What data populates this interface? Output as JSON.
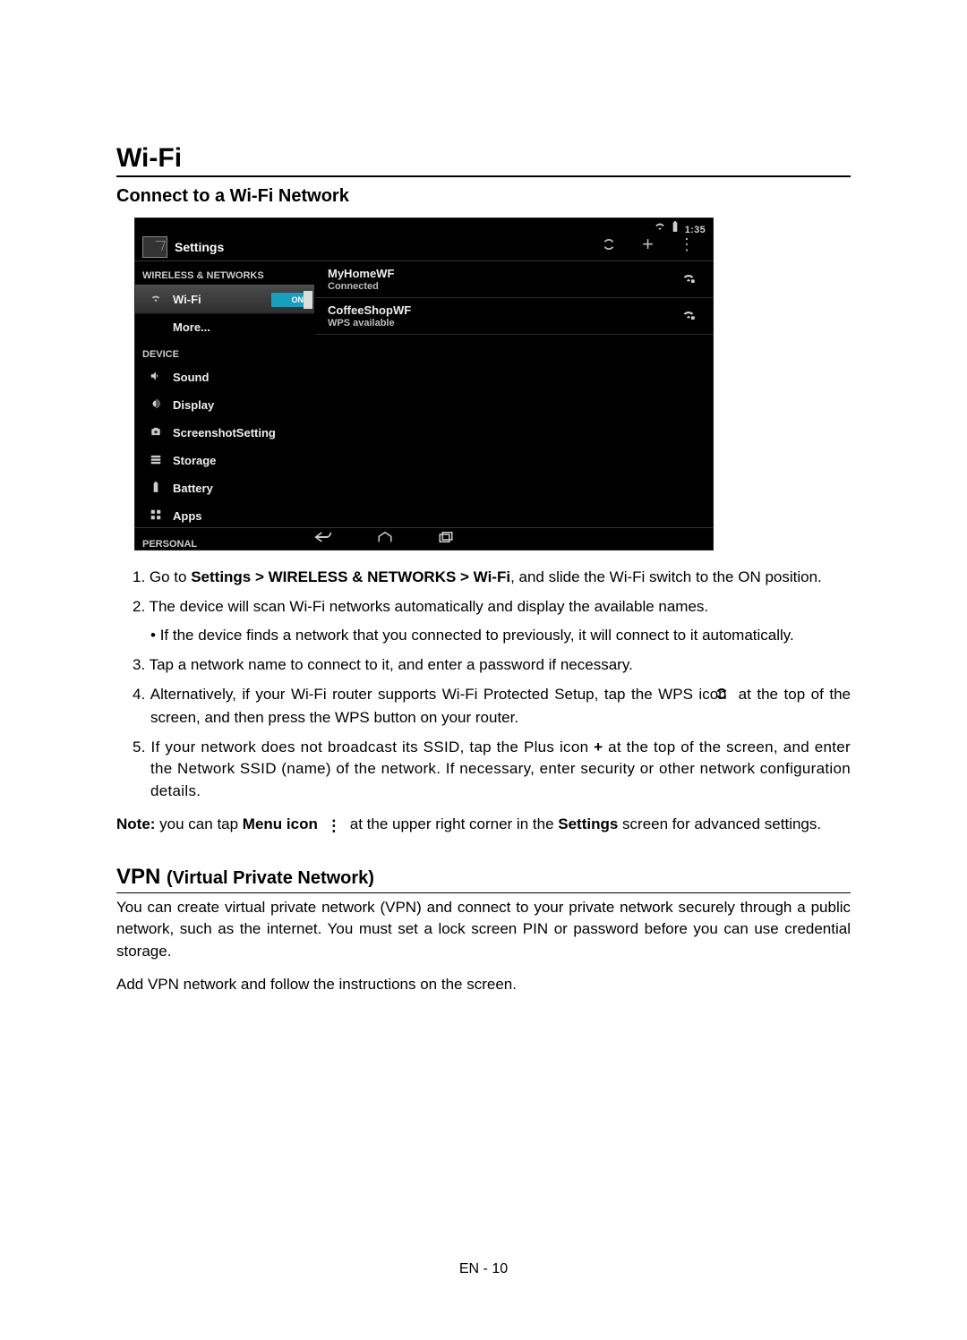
{
  "page": {
    "footer": "EN - 10"
  },
  "section": {
    "title": "Wi-Fi",
    "subtitle": "Connect to a Wi-Fi Network"
  },
  "screenshot": {
    "status": {
      "time": "1:35"
    },
    "titlebar": {
      "title": "Settings"
    },
    "sidebar": {
      "headers": {
        "wireless": "WIRELESS & NETWORKS",
        "device": "DEVICE",
        "personal": "PERSONAL"
      },
      "items": {
        "wifi": {
          "label": "Wi-Fi",
          "toggle": "ON"
        },
        "more": {
          "label": "More..."
        },
        "sound": {
          "label": "Sound"
        },
        "display": {
          "label": "Display"
        },
        "sshot": {
          "label": "ScreenshotSetting"
        },
        "storage": {
          "label": "Storage"
        },
        "battery": {
          "label": "Battery"
        },
        "apps": {
          "label": "Apps"
        }
      }
    },
    "networks": [
      {
        "name": "MyHomeWF",
        "sub": "Connected"
      },
      {
        "name": "CoffeeShopWF",
        "sub": "WPS available"
      }
    ]
  },
  "instructions": {
    "i1a": "1. Go to ",
    "i1b": "Settings > WIRELESS & NETWORKS > Wi-Fi",
    "i1c": ", and slide the Wi-Fi switch to the ON position.",
    "i2": "2. The device will scan Wi-Fi networks automatically and display the available names.",
    "i2b": "If the device finds a network that you connected to previously, it will connect to it automatically.",
    "i3": "3. Tap a network name to connect to it, and enter a password if necessary.",
    "i4a": "4. Alternatively, if your Wi-Fi router supports Wi-Fi Protected Setup, tap the WPS icon ",
    "i4b": " at the top of the screen, and then press the WPS button on your router.",
    "i5a": "5. If your network does not broadcast its SSID, tap the Plus icon ",
    "i5b": "+",
    "i5c": " at the top of the screen, and enter the Network SSID (name) of the network. If necessary, enter security or other network configuration details.",
    "note_a": "Note:",
    "note_b": " you can tap ",
    "note_c": "Menu icon",
    "note_d": " at the upper right corner in the ",
    "note_e": "Settings",
    "note_f": " screen for advanced settings."
  },
  "vpn": {
    "title_a": "VPN ",
    "title_b": "(Virtual Private Network)",
    "p1": "You can create virtual private network (VPN) and connect to your private network securely through a public network, such as the internet. You must set a lock screen PIN or password before you can use credential storage.",
    "p2": "Add VPN network and follow the instructions on the screen."
  }
}
